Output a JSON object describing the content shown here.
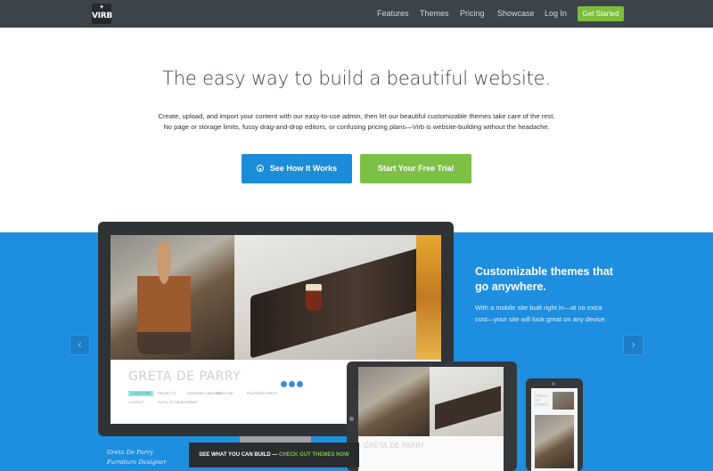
{
  "nav": {
    "logo": "VIRB",
    "links": [
      "Features",
      "Themes",
      "Pricing",
      "Showcase",
      "Log In"
    ],
    "cta": "Get Started"
  },
  "hero": {
    "headline": "The easy way to build a beautiful website.",
    "subtext_line1": "Create, upload, and import your content with our easy-to-use admin, then let our beautiful customizable themes take care of the rest.",
    "subtext_line2": "No page or storage limits, fussy drag-and-drop editors, or confusing pricing plans—Virb is website-building without the headache.",
    "button_how": "See How It Works",
    "button_trial": "Start Your Free Trial"
  },
  "showcase": {
    "feature_title": "Customizable themes that go anywhere.",
    "feature_text": "With a mobile site built right in—at no extra cost—your site will look great on any device.",
    "arrow_left": "‹",
    "arrow_right": "›",
    "site_name": "GRETA DE PARRY",
    "site_menu_row1": [
      "FURNITURE",
      "PROJECTS",
      "DESIGNED OBJECTS",
      "ABOUT ME",
      "FEATURED PRESS"
    ],
    "site_menu_row2": [
      "CONTACT",
      "SUPLY TV OBJECT",
      "NEWS"
    ],
    "caption_name": "Greta De Parry",
    "caption_role": "Furniture Designer",
    "themes_bar_prefix": "SEE WHAT YOU CAN BUILD — ",
    "themes_bar_link": "CHECK OUT THEMES NOW",
    "tablet_name": "GRETA DE PARRY",
    "phone_name": "GRETA DE PARRY"
  },
  "colors": {
    "nav_bg": "#3c4449",
    "band_blue": "#1d8ee0",
    "button_blue": "#1b8cd8",
    "button_green": "#7cc046"
  }
}
